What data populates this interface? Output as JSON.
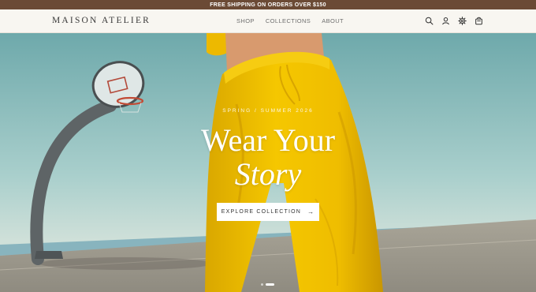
{
  "announcement": {
    "text": "FREE SHIPPING ON ORDERS OVER $150"
  },
  "header": {
    "logo": "MAISON ATELIER",
    "nav": [
      "SHOP",
      "COLLECTIONS",
      "ABOUT"
    ],
    "icons": [
      "search-icon",
      "account-icon",
      "settings-icon",
      "cart-icon"
    ]
  },
  "hero": {
    "eyebrow": "SPRING / SUMMER 2026",
    "headline_line1": "Wear Your",
    "headline_line2": "Story",
    "cta_label": "EXPLORE COLLECTION",
    "cta_arrow": "→",
    "slides": {
      "count": 2,
      "active": 2
    }
  },
  "colors": {
    "announcement_bg": "#6b4a35",
    "header_bg": "#f8f6f1",
    "sky": "#7fb6b8",
    "garment_yellow": "#f2c200"
  }
}
